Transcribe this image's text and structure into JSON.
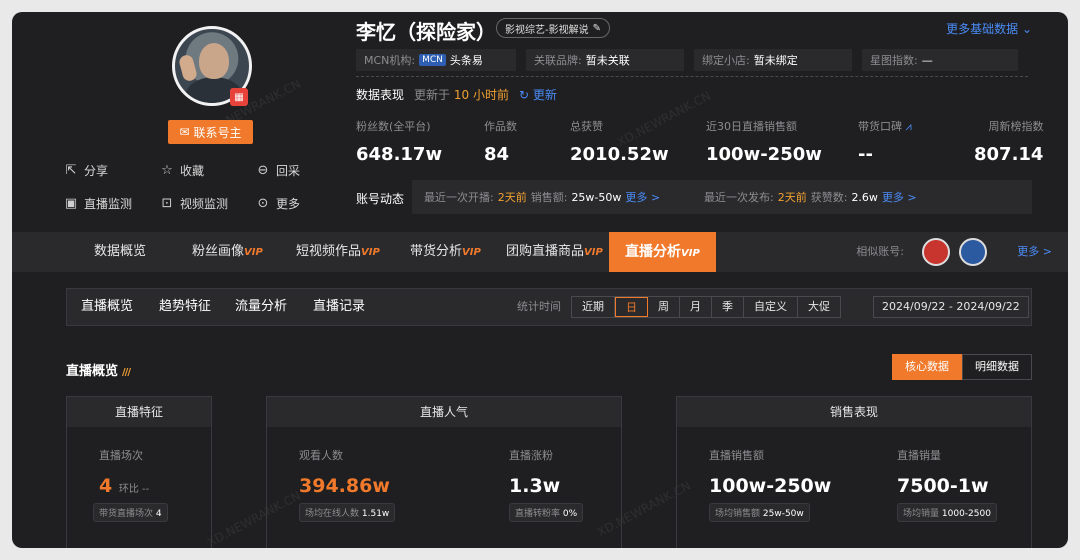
{
  "profile": {
    "name": "李忆（探险家）",
    "tag": "影视综艺-影视解说",
    "more_basic": "更多基础数据",
    "contact_label": "联系号主",
    "info": [
      {
        "label": "MCN机构:",
        "badge": "MCN",
        "value": "头条易"
      },
      {
        "label": "关联品牌:",
        "value": "暂未关联"
      },
      {
        "label": "绑定小店:",
        "value": "暂未绑定"
      },
      {
        "label": "星图指数:",
        "value": "—"
      }
    ],
    "actions": [
      {
        "icon": "share-icon",
        "label": "分享"
      },
      {
        "icon": "star-icon",
        "label": "收藏"
      },
      {
        "icon": "return-icon",
        "label": "回采"
      },
      {
        "icon": "live-monitor-icon",
        "label": "直播监测"
      },
      {
        "icon": "video-monitor-icon",
        "label": "视频监测"
      },
      {
        "icon": "more-icon",
        "label": "更多"
      }
    ]
  },
  "performance": {
    "title": "数据表现",
    "updated_prefix": "更新于",
    "updated_time": "10 小时前",
    "refresh_label": "更新"
  },
  "stats": [
    {
      "label": "粉丝数(全平台)",
      "value": "648.17w"
    },
    {
      "label": "作品数",
      "value": "84"
    },
    {
      "label": "总获赞",
      "value": "2010.52w"
    },
    {
      "label": "近30日直播销售额",
      "value": "100w-250w"
    },
    {
      "label": "带货口碑",
      "value": "--"
    },
    {
      "label": "周新榜指数",
      "value": "807.14"
    }
  ],
  "dynamics": {
    "label": "账号动态",
    "live": {
      "prefix": "最近一次开播:",
      "when": "2天前",
      "sales_label": "销售额:",
      "sales": "25w-50w",
      "more": "更多 >"
    },
    "post": {
      "prefix": "最近一次发布:",
      "when": "2天前",
      "likes_label": "获赞数:",
      "likes": "2.6w",
      "more": "更多 >"
    }
  },
  "nav": {
    "tabs": [
      {
        "label": "数据概览",
        "vip": ""
      },
      {
        "label": "粉丝画像",
        "vip": "VIP"
      },
      {
        "label": "短视频作品",
        "vip": "VIP"
      },
      {
        "label": "带货分析",
        "vip": "VIP"
      },
      {
        "label": "团购直播商品",
        "vip": "VIP"
      },
      {
        "label": "直播分析",
        "vip": "VIP"
      }
    ],
    "similar_label": "相似账号:",
    "similar_more": "更多 >"
  },
  "subnav": {
    "tabs": [
      "直播概览",
      "趋势特征",
      "流量分析",
      "直播记录"
    ],
    "time_label": "统计时间",
    "periods": [
      "近期",
      "日",
      "周",
      "月",
      "季",
      "自定义",
      "大促"
    ],
    "active_period": "日",
    "date_range": "2024/09/22 - 2024/09/22"
  },
  "overview": {
    "title": "直播概览",
    "toggle": [
      "核心数据",
      "明细数据"
    ],
    "cards": {
      "features": {
        "title": "直播特征",
        "label": "直播场次",
        "value": "4",
        "hb": "环比 --",
        "sub_label": "带货直播场次",
        "sub_value": "4"
      },
      "popularity": {
        "title": "直播人气",
        "viewers_label": "观看人数",
        "viewers": "394.86w",
        "viewers_sub_label": "场均在线人数",
        "viewers_sub": "1.51w",
        "fans_label": "直播涨粉",
        "fans": "1.3w",
        "fans_sub_label": "直播转粉率",
        "fans_sub": "0%"
      },
      "sales": {
        "title": "销售表现",
        "amount_label": "直播销售额",
        "amount": "100w-250w",
        "amount_sub_label": "场均销售额",
        "amount_sub": "25w-50w",
        "volume_label": "直播销量",
        "volume": "7500-1w",
        "volume_sub_label": "场均销量",
        "volume_sub": "1000-2500"
      }
    }
  },
  "watermark": "XD.NEWRANK.CN",
  "colors": {
    "accent": "#f0792b",
    "link": "#4a8cf7",
    "highlight": "#f0a030",
    "bg": "#1f1f21"
  }
}
